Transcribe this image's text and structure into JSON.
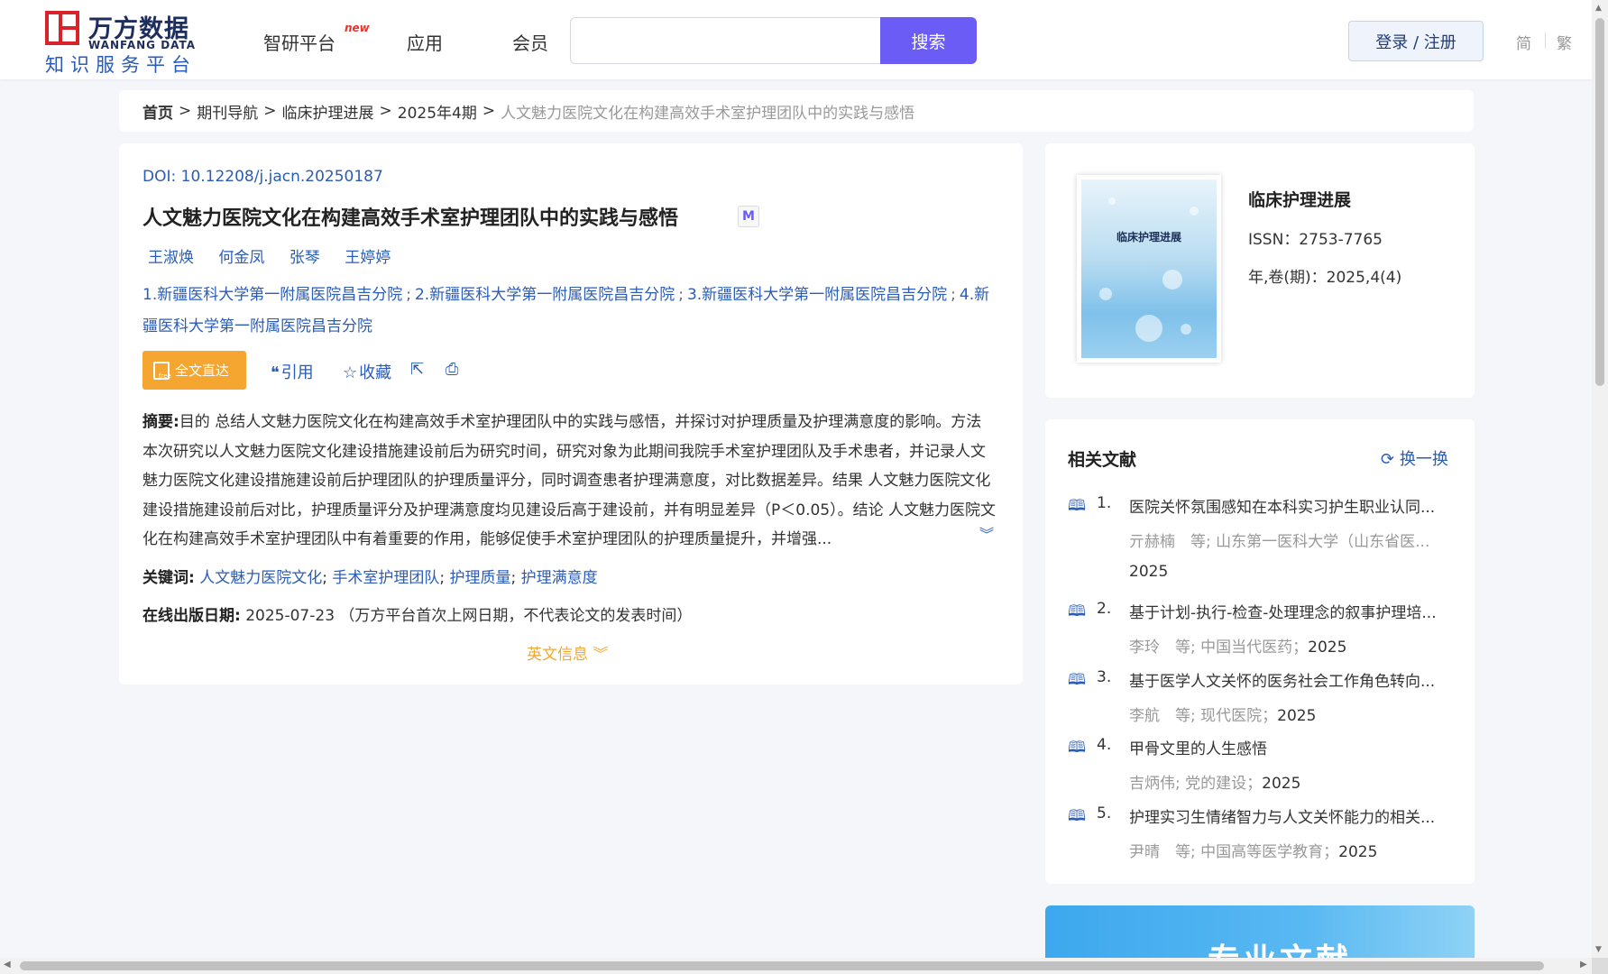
{
  "logo": {
    "cn": "万方数据",
    "en": "WANFANG DATA",
    "sub": "知识服务平台"
  },
  "nav": {
    "items": [
      "智研平台",
      "应用",
      "会员"
    ],
    "new_badge": "new"
  },
  "search": {
    "value": "",
    "placeholder": "",
    "button": "搜索"
  },
  "header_right": {
    "login": "登录 / 注册",
    "simplified": "简",
    "traditional": "繁"
  },
  "breadcrumb": {
    "home": "首页",
    "items": [
      "期刊导航",
      "临床护理进展",
      "2025年4期"
    ],
    "current": "人文魅力医院文化在构建高效手术室护理团队中的实践与感悟",
    "sep": ">"
  },
  "article": {
    "doi_label": "DOI:",
    "doi": "10.12208/j.jacn.20250187",
    "title": "人文魅力医院文化在构建高效手术室护理团队中的实践与感悟",
    "m_badge": "M",
    "authors": [
      "王淑焕",
      "何金凤",
      "张琴",
      "王婷婷"
    ],
    "affiliations": [
      "1.新疆医科大学第一附属医院昌吉分院",
      "2.新疆医科大学第一附属医院昌吉分院",
      "3.新疆医科大学第一附属医院昌吉分院",
      "4.新疆医科大学第一附属医院昌吉分院"
    ],
    "affil_sep": ";",
    "fulltext": "全文直达",
    "cite": "引用",
    "collect": "收藏",
    "abstract_label": "摘要:",
    "abstract": "目的 总结人文魅力医院文化在构建高效手术室护理团队中的实践与感悟，并探讨对护理质量及护理满意度的影响。方法 本次研究以人文魅力医院文化建设措施建设前后为研究时间，研究对象为此期间我院手术室护理团队及手术患者，并记录人文魅力医院文化建设措施建设前后护理团队的护理质量评分，同时调查患者护理满意度，对比数据差异。结果 人文魅力医院文化建设措施建设前后对比，护理质量评分及护理满意度均见建设后高于建设前，并有明显差异（P＜0.05）。结论 人文魅力医院文化在构建高效手术室护理团队中有着重要的作用，能够促使手术室护理团队的护理质量提升，并增强...",
    "keywords_label": "关键词:",
    "keywords": [
      "人文魅力医院文化",
      "手术室护理团队",
      "护理质量",
      "护理满意度"
    ],
    "kw_sep": ";",
    "pubdate_label": "在线出版日期:",
    "pubdate": "2025-07-23",
    "pubdate_note": "（万方平台首次上网日期，不代表论文的发表时间）",
    "english_info": "英文信息"
  },
  "journal": {
    "cover_title": "临床护理进展",
    "name": "临床护理进展",
    "issn": "ISSN：2753-7765",
    "volume": "年,卷(期)：2025,4(4)"
  },
  "related": {
    "title": "相关文献",
    "refresh": "换一换",
    "items": [
      {
        "num": "1.",
        "title": "医院关怀氛围感知在本科实习护生职业认同...",
        "meta": "亓赫楠　等;  山东第一医科大学（山东省医...",
        "year": "2025"
      },
      {
        "num": "2.",
        "title": "基于计划-执行-检查-处理理念的叙事护理培...",
        "meta": "李玲　等;  中国当代医药；",
        "year": "2025"
      },
      {
        "num": "3.",
        "title": "基于医学人文关怀的医务社会工作角色转向...",
        "meta": "李航　等;  现代医院；",
        "year": "2025"
      },
      {
        "num": "4.",
        "title": "甲骨文里的人生感悟",
        "meta": "吉炳伟;  党的建设；",
        "year": "2025"
      },
      {
        "num": "5.",
        "title": "护理实习生情绪智力与人文关怀能力的相关...",
        "meta": "尹晴　等;  中国高等医学教育；",
        "year": "2025"
      }
    ]
  },
  "banner": {
    "text": "专业文献"
  },
  "icons": {
    "book": "book-icon",
    "refresh": "refresh-icon",
    "quote": "quote-icon",
    "star": "star-icon",
    "share": "share-icon",
    "print": "print-icon"
  },
  "colors": {
    "accent": "#6b5cf6",
    "link": "#2a5cb8",
    "orange": "#f4a631"
  }
}
